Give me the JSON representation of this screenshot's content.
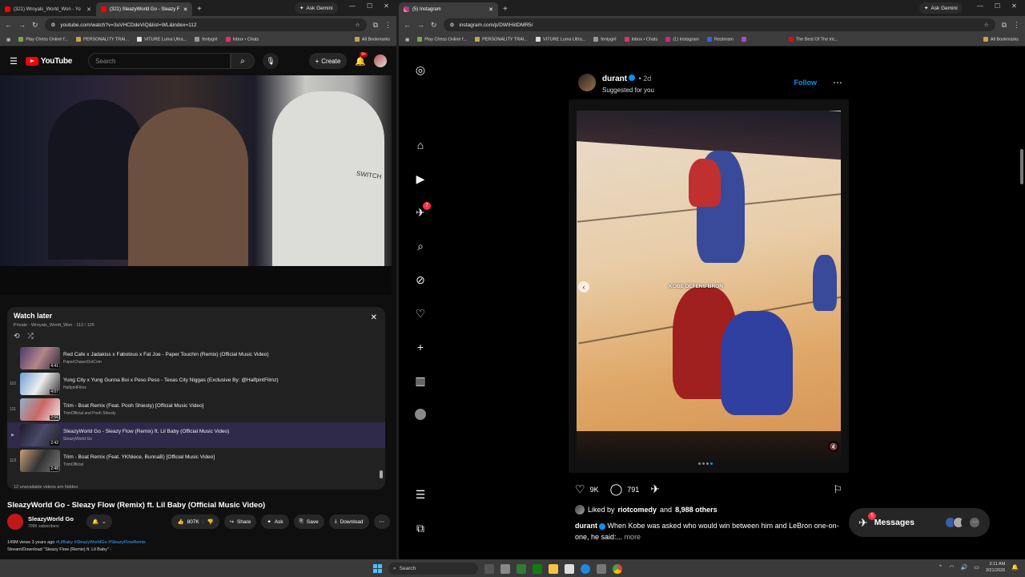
{
  "left_browser": {
    "tabs": [
      {
        "title": "(321) Wroyals_World_Won - Yo",
        "active": false
      },
      {
        "title": "(321) SleazyWorld Go - Sleazy F",
        "active": true
      }
    ],
    "ask_gemini": "Ask Gemini",
    "url": "youtube.com/watch?v=3uVHCDdeViQ&list=WL&index=112",
    "bookmarks": [
      "Play Chess Online f...",
      "PERSONALITY TRAI...",
      "VITURE Luma Ultra...",
      "fentygirl",
      "Inbox • Chats"
    ],
    "all_bookmarks": "All Bookmarks"
  },
  "youtube": {
    "logo_text": "YouTube",
    "search_placeholder": "Search",
    "create_label": "Create",
    "notif_count": "9+",
    "video_overlay_text": "SWITCH",
    "watch_later": {
      "title": "Watch later",
      "subtitle": "Private · Wroyals_World_Won · 112 / 125",
      "items": [
        {
          "index": "",
          "title": "Red Cafe x Jadakiss x Fabolous x Fat Joe - Paper Touchin (Remix) (Official Music Video)",
          "channel": "PaperChaserDotCom",
          "duration": "4:41",
          "current": false
        },
        {
          "index": "110",
          "title": "Yung City x Yung Gunna Boi x Peso Peso - Texas City Niggas (Exclusive By: @HalfpintFilmz)",
          "channel": "HalfpintFilmz",
          "duration": "4:07",
          "current": false
        },
        {
          "index": "111",
          "title": "Trim - Boat Remix (Feat. Pooh Shiesty) [Official Music Video]",
          "channel": "TrimOfficial and Pooh Shiesty",
          "duration": "2:56",
          "current": false
        },
        {
          "index": "▶",
          "title": "SleazyWorld Go - Sleazy Flow (Remix) ft. Lil Baby (Official Music Video)",
          "channel": "SleazyWorld Go",
          "duration": "2:42",
          "current": true
        },
        {
          "index": "113",
          "title": "Trim - Boat Remix (Feat. YKNiece, BunnaB) [Official Music Video]",
          "channel": "TrimOfficial",
          "duration": "2:48",
          "current": false
        }
      ],
      "footer": "12 unavailable videos are hidden"
    },
    "video_title": "SleazyWorld Go - Sleazy Flow (Remix) ft. Lil Baby (Official Music Video)",
    "channel_name": "SleazyWorld Go",
    "subscribers": "709K subscribers",
    "likes": "807K",
    "share": "Share",
    "ask": "Ask",
    "save": "Save",
    "download": "Download",
    "desc_stats": "149M views  3 years ago",
    "desc_tags": "#LilBaby #SleazyWorldGo #SleazyFlowRemix",
    "desc_line2": "Stream/Download \"Sleazy Flow (Remix) ft. Lil Baby\" -"
  },
  "right_browser": {
    "tab_title": "(5) Instagram",
    "ask_gemini": "Ask Gemini",
    "url": "instagram.com/p/DWIHiitDMR5/",
    "bookmarks": [
      "Play Chess Online f...",
      "PERSONALITY TRAI...",
      "VITURE Luma Ultra...",
      "fentygirl",
      "Inbox • Chats",
      "(1) Instagram",
      "Restream",
      "",
      "The Best Of The Int..."
    ],
    "all_bookmarks": "All Bookmarks"
  },
  "instagram": {
    "notif_badge": "7",
    "post": {
      "username": "durant",
      "time": "• 2d",
      "suggested": "Suggested for you",
      "follow": "Follow",
      "overlay_caption": "KOBE DEFENS BRON",
      "likes": "9K",
      "comments": "791",
      "liked_by_user": "riotcomedy",
      "liked_by_others": "8,988 others",
      "caption_user": "durant",
      "caption_text": "When Kobe was asked who would win between him and LeBron one-on-one, he said:...",
      "more": "more"
    },
    "messages": {
      "label": "Messages",
      "badge": "5"
    }
  },
  "taskbar": {
    "search": "Search",
    "time": "3:11 AM",
    "date": "3/21/2026"
  },
  "colors": {
    "youtube_red": "#ff0000",
    "ig_blue": "#0095f6",
    "ig_badge": "#ff3040",
    "win_accent": "#4cc2ff"
  }
}
